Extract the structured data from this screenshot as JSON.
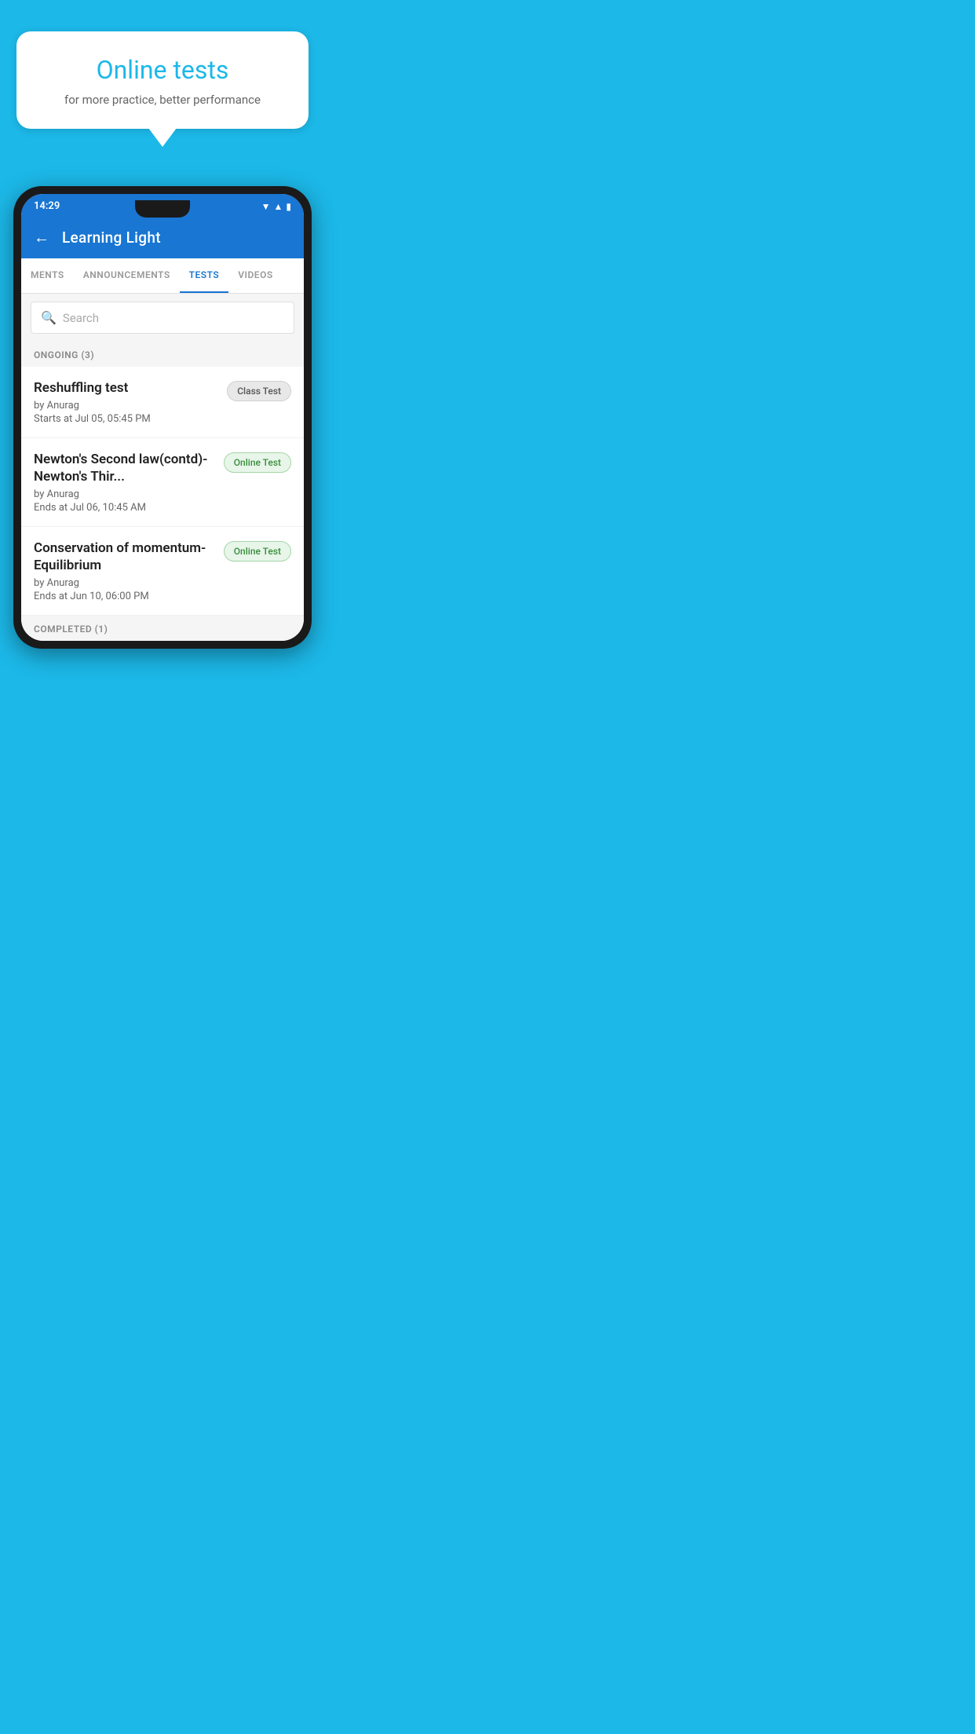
{
  "background_color": "#1cb8e8",
  "speech_bubble": {
    "title": "Online tests",
    "subtitle": "for more practice, better performance"
  },
  "phone": {
    "status_bar": {
      "time": "14:29",
      "icons": [
        "wifi",
        "signal",
        "battery"
      ]
    },
    "app_bar": {
      "back_label": "←",
      "title": "Learning Light"
    },
    "tabs": [
      {
        "label": "MENTS",
        "active": false
      },
      {
        "label": "ANNOUNCEMENTS",
        "active": false
      },
      {
        "label": "TESTS",
        "active": true
      },
      {
        "label": "VIDEOS",
        "active": false
      }
    ],
    "search": {
      "placeholder": "Search"
    },
    "ongoing_section": {
      "label": "ONGOING (3)"
    },
    "tests": [
      {
        "title": "Reshuffling test",
        "by": "by Anurag",
        "time_label": "Starts at",
        "time": "Jul 05, 05:45 PM",
        "badge": "Class Test",
        "badge_type": "class"
      },
      {
        "title": "Newton's Second law(contd)-Newton's Thir...",
        "by": "by Anurag",
        "time_label": "Ends at",
        "time": "Jul 06, 10:45 AM",
        "badge": "Online Test",
        "badge_type": "online"
      },
      {
        "title": "Conservation of momentum-Equilibrium",
        "by": "by Anurag",
        "time_label": "Ends at",
        "time": "Jun 10, 06:00 PM",
        "badge": "Online Test",
        "badge_type": "online"
      }
    ],
    "completed_section": {
      "label": "COMPLETED (1)"
    }
  }
}
